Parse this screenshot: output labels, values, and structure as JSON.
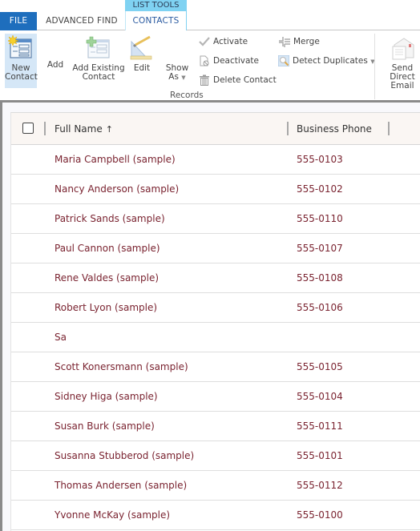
{
  "tabs": {
    "file": "FILE",
    "advanced_find": "ADVANCED FIND",
    "context_group": "LIST TOOLS",
    "contacts": "CONTACTS"
  },
  "ribbon": {
    "new_contact": [
      "New",
      "Contact"
    ],
    "add": "Add",
    "add_existing_contact": [
      "Add Existing",
      "Contact"
    ],
    "edit": "Edit",
    "show_as": [
      "Show",
      "As"
    ],
    "activate": "Activate",
    "deactivate": "Deactivate",
    "delete_contact": "Delete Contact",
    "merge": "Merge",
    "detect_duplicates": "Detect Duplicates",
    "group_label": "Records",
    "send_direct_email": [
      "Send Direct",
      "Email"
    ]
  },
  "grid": {
    "columns": {
      "full_name": "Full Name",
      "sort_indicator": "↑",
      "business_phone": "Business Phone"
    },
    "rows": [
      {
        "name": "Maria Campbell (sample)",
        "phone": "555-0103"
      },
      {
        "name": "Nancy Anderson (sample)",
        "phone": "555-0102"
      },
      {
        "name": "Patrick Sands (sample)",
        "phone": "555-0110"
      },
      {
        "name": "Paul Cannon (sample)",
        "phone": "555-0107"
      },
      {
        "name": "Rene Valdes (sample)",
        "phone": "555-0108"
      },
      {
        "name": "Robert Lyon (sample)",
        "phone": "555-0106"
      },
      {
        "name": "Sa",
        "phone": ""
      },
      {
        "name": "Scott Konersmann (sample)",
        "phone": "555-0105"
      },
      {
        "name": "Sidney Higa (sample)",
        "phone": "555-0104"
      },
      {
        "name": "Susan Burk (sample)",
        "phone": "555-0111"
      },
      {
        "name": "Susanna Stubberod (sample)",
        "phone": "555-0101"
      },
      {
        "name": "Thomas Andersen (sample)",
        "phone": "555-0112"
      },
      {
        "name": "Yvonne McKay (sample)",
        "phone": "555-0100"
      }
    ]
  },
  "colors": {
    "file_tab": "#1e6ebd",
    "context_tab": "#7fd2f2",
    "link_text": "#7a2330",
    "header_bg": "#faf6f3"
  }
}
